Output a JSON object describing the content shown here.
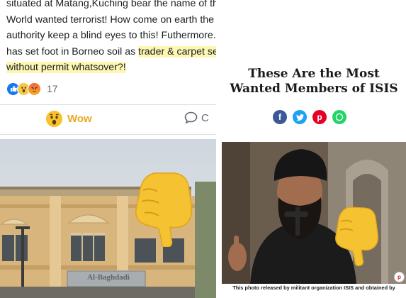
{
  "post": {
    "text_lines": [
      "situated at Matang,Kuching bear the name of the",
      "World wanted terrorist! How come on earth the",
      "authority keep a blind eyes to this! Futhermore...they",
      "has set foot in Borneo soil as ",
      "trader & carpet seller",
      "without permit whatsover?!"
    ],
    "reaction_count": "17",
    "reactions": [
      "like-icon",
      "wow-icon",
      "angry-icon"
    ],
    "actions": {
      "wow_label": "Wow",
      "comment_label": "C"
    },
    "highlight_color": "#fdf7b3",
    "wow_color": "#e9a823"
  },
  "building_sign": "Al-Baghdadi",
  "article": {
    "title_line1": "These Are the Most",
    "title_line2": "Wanted Members of ISIS",
    "share_icons": [
      {
        "name": "facebook-share-icon",
        "glyph": "f",
        "color": "#3b5998"
      },
      {
        "name": "twitter-share-icon",
        "glyph": "t",
        "color": "#1da1f2"
      },
      {
        "name": "pinterest-share-icon",
        "glyph": "p",
        "color": "#e60023"
      },
      {
        "name": "whatsapp-share-icon",
        "glyph": "w",
        "color": "#25d366"
      }
    ],
    "caption": "This photo released by militant organization ISIS and obtained by"
  }
}
